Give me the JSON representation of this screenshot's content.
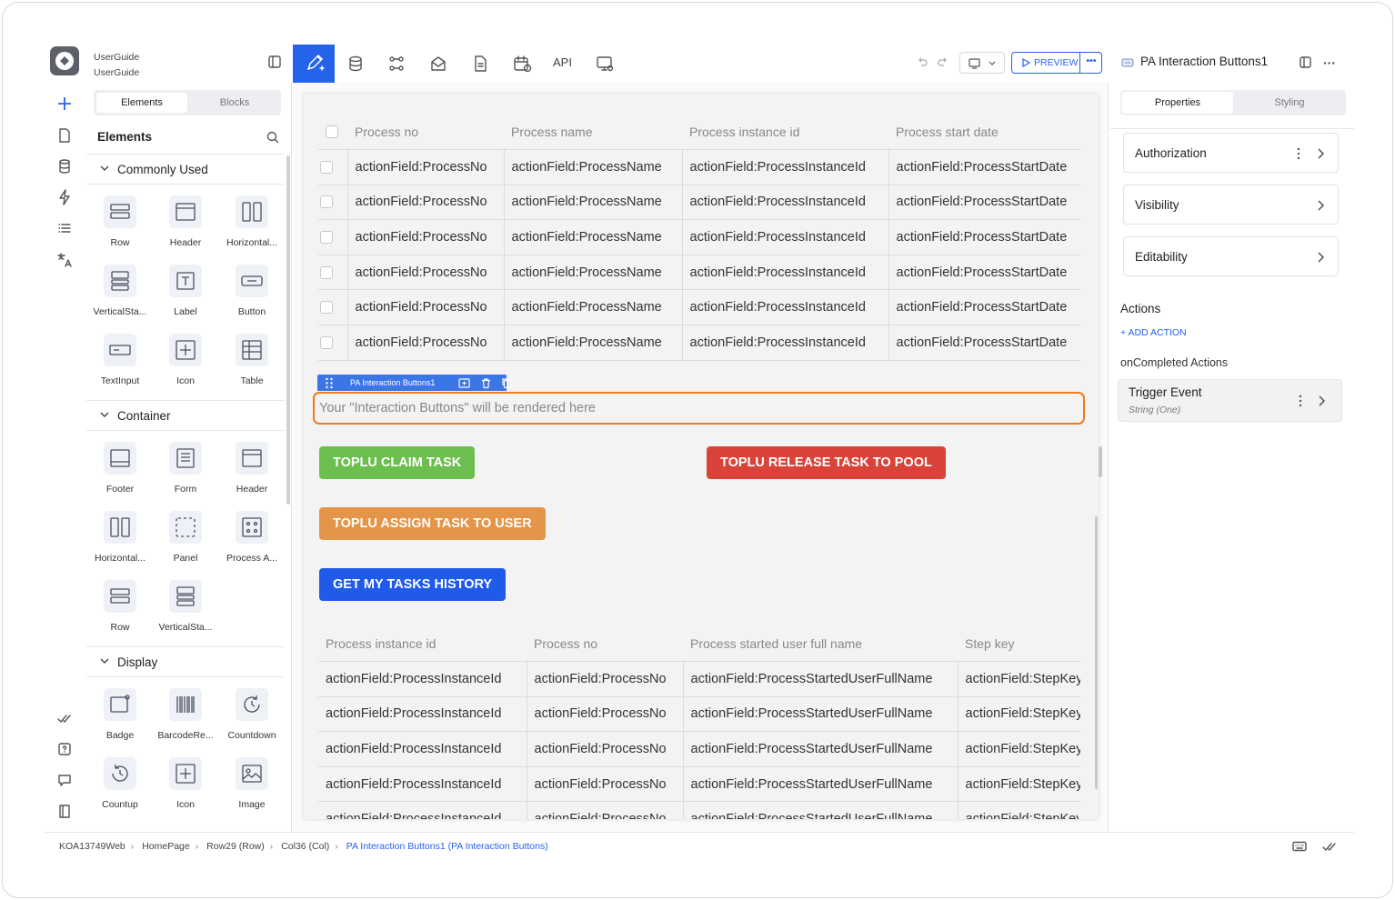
{
  "app": {
    "name_top": "UserGuide",
    "name_bottom": "UserGuide"
  },
  "rail": {
    "icons": [
      "plus-icon",
      "page-icon",
      "database-icon",
      "bolt-icon",
      "list-icon",
      "translate-icon"
    ],
    "bottom_icons": [
      "double-check-icon",
      "help-icon",
      "chat-icon",
      "book-icon"
    ]
  },
  "left_panel": {
    "tabs": {
      "elements": "Elements",
      "blocks": "Blocks"
    },
    "title": "Elements",
    "sections": {
      "common": {
        "label": "Commonly Used",
        "items": [
          "Row",
          "Header",
          "Horizontal...",
          "VerticalSta...",
          "Label",
          "Button",
          "TextInput",
          "Icon",
          "Table"
        ]
      },
      "container": {
        "label": "Container",
        "items": [
          "Footer",
          "Form",
          "Header",
          "Horizontal...",
          "Panel",
          "Process A...",
          "Row",
          "VerticalSta..."
        ]
      },
      "display": {
        "label": "Display",
        "items": [
          "Badge",
          "BarcodeRe...",
          "Countdown",
          "Countup",
          "Icon",
          "Image"
        ]
      }
    }
  },
  "toolbar": {
    "api_label": "API",
    "preview_label": "PREVIEW",
    "more_label": "•••"
  },
  "canvas": {
    "table1": {
      "headers": [
        "Process no",
        "Process name",
        "Process instance id",
        "Process start date"
      ],
      "row": [
        "actionField:ProcessNo",
        "actionField:ProcessName",
        "actionField:ProcessInstanceId",
        "actionField:ProcessStartDate"
      ],
      "row_count": 6
    },
    "selection_label": "PA Interaction Buttons1",
    "placeholder": "Your \"Interaction Buttons\" will be rendered here",
    "buttons": {
      "claim": "TOPLU CLAIM TASK",
      "release": "TOPLU RELEASE TASK TO POOL",
      "assign": "TOPLU ASSIGN TASK TO USER",
      "history": "GET MY TASKS HISTORY"
    },
    "colors": {
      "claim": "#6cbf4e",
      "release": "#d9433a",
      "assign": "#e3954a",
      "history": "#1f5ae8"
    },
    "table2": {
      "headers": [
        "Process instance id",
        "Process no",
        "Process started user full name",
        "Step key"
      ],
      "row": [
        "actionField:ProcessInstanceId",
        "actionField:ProcessNo",
        "actionField:ProcessStartedUserFullName",
        "actionField:StepKey"
      ],
      "row_count": 5
    }
  },
  "right_panel": {
    "title": "PA Interaction Buttons1",
    "tabs": {
      "properties": "Properties",
      "styling": "Styling"
    },
    "cards": [
      "Authorization",
      "Visibility",
      "Editability"
    ],
    "actions_title": "Actions",
    "add_action": "+ ADD ACTION",
    "on_completed": "onCompleted Actions",
    "trigger": {
      "title": "Trigger Event",
      "subtitle": "String (One)"
    }
  },
  "breadcrumb": [
    "KOA13749Web",
    "HomePage",
    "Row29 (Row)",
    "Col36 (Col)",
    "PA Interaction Buttons1 (PA Interaction Buttons)"
  ]
}
